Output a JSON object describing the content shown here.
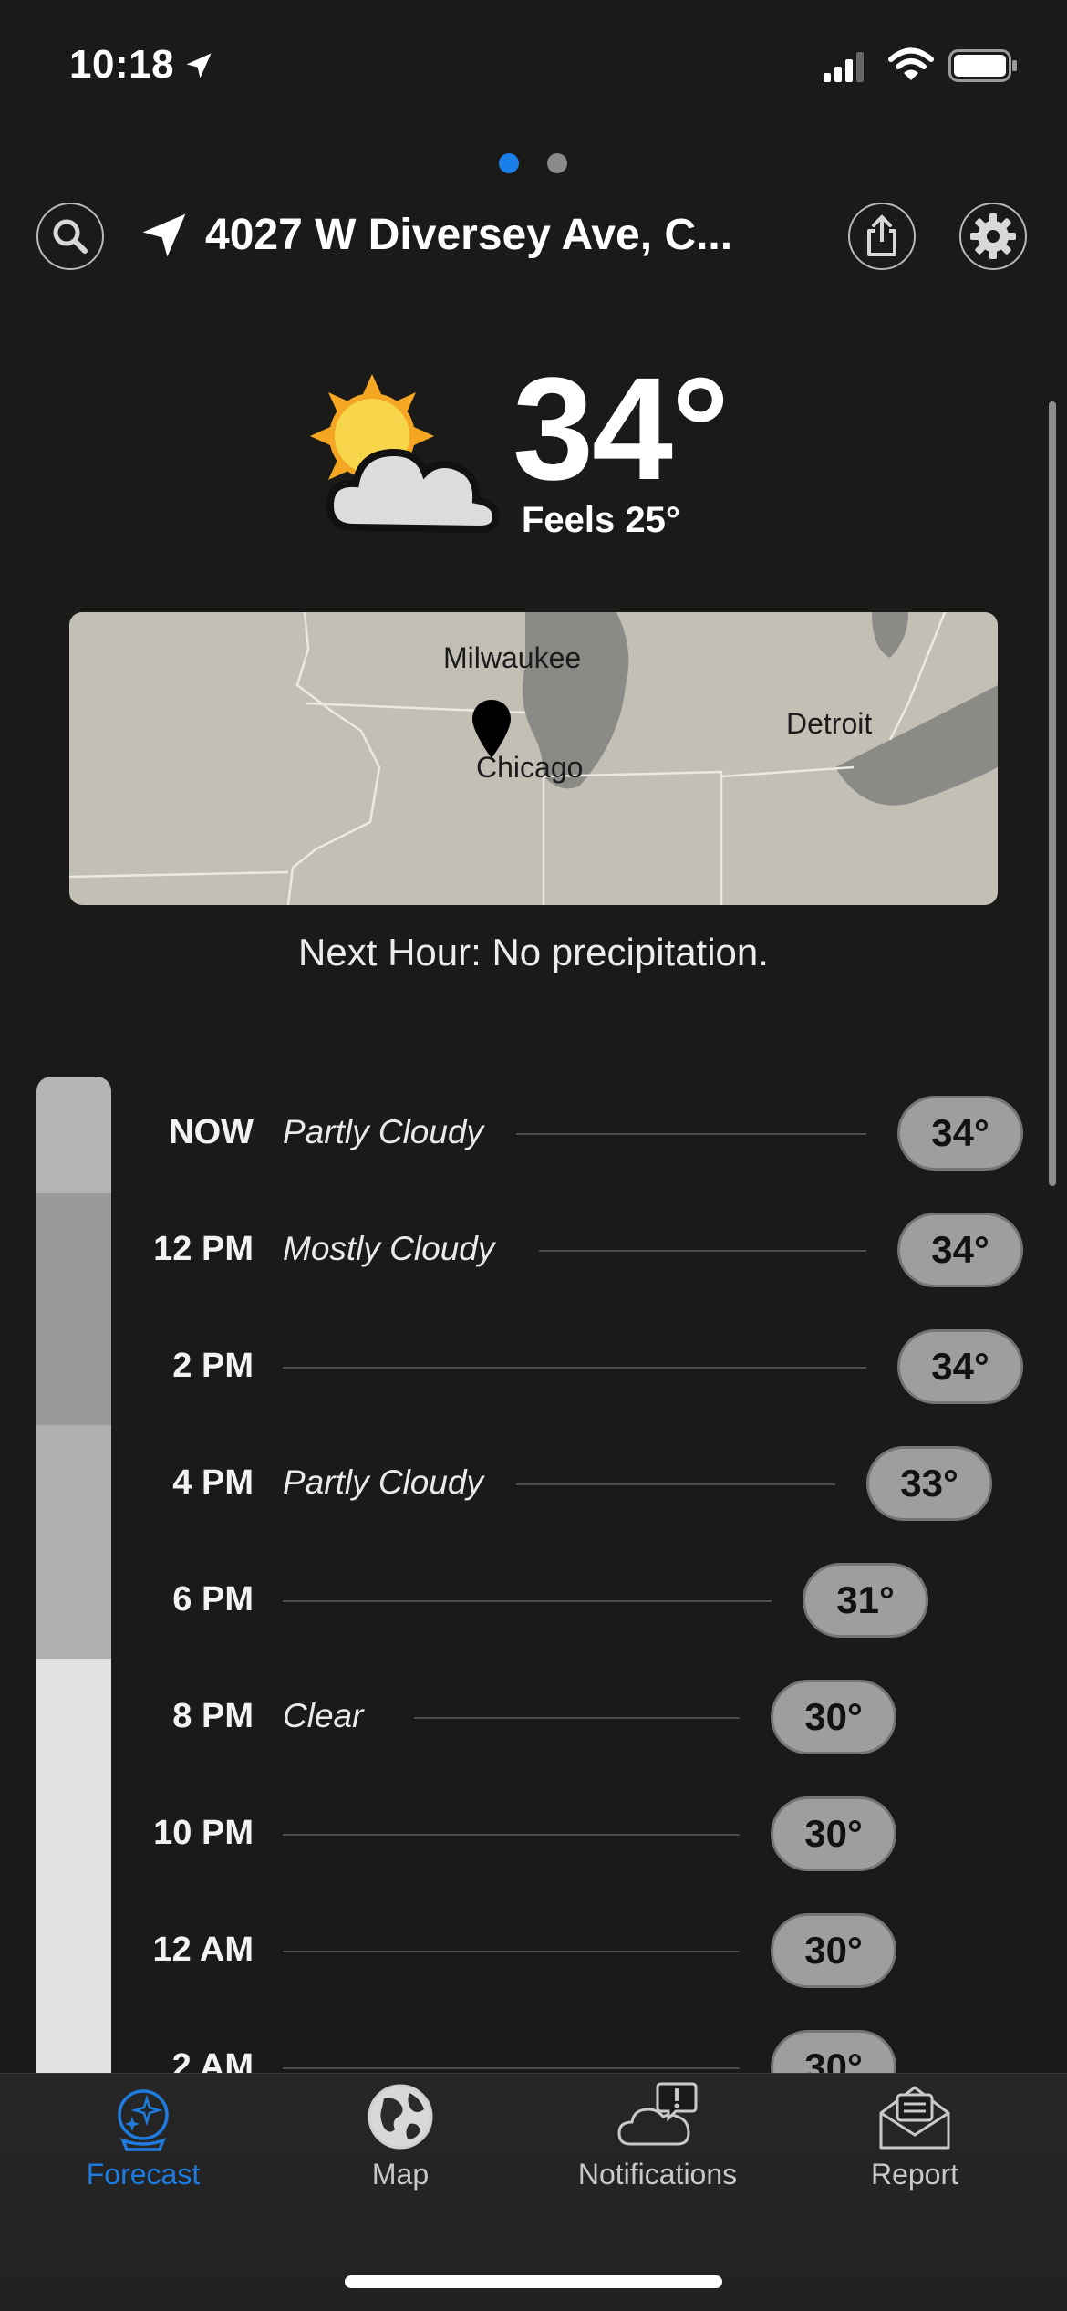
{
  "status_bar": {
    "time": "10:18"
  },
  "header": {
    "address": "4027 W Diversey Ave, C..."
  },
  "current": {
    "temperature": "34°",
    "feels_like": "Feels 25°",
    "icon": "partly-cloudy-icon"
  },
  "map": {
    "labels": {
      "milwaukee": "Milwaukee",
      "chicago": "Chicago",
      "detroit": "Detroit"
    }
  },
  "next_hour": "Next Hour: No precipitation.",
  "hourly": [
    {
      "time": "NOW",
      "condition": "Partly Cloudy",
      "temp": "34°"
    },
    {
      "time": "12 PM",
      "condition": "Mostly Cloudy",
      "temp": "34°"
    },
    {
      "time": "2 PM",
      "condition": "",
      "temp": "34°"
    },
    {
      "time": "4 PM",
      "condition": "Partly Cloudy",
      "temp": "33°"
    },
    {
      "time": "6 PM",
      "condition": "",
      "temp": "31°"
    },
    {
      "time": "8 PM",
      "condition": "Clear",
      "temp": "30°"
    },
    {
      "time": "10 PM",
      "condition": "",
      "temp": "30°"
    },
    {
      "time": "12 AM",
      "condition": "",
      "temp": "30°"
    },
    {
      "time": "2 AM",
      "condition": "",
      "temp": "30°"
    }
  ],
  "tabs": [
    {
      "label": "Forecast",
      "icon": "crystal-ball-icon",
      "active": true
    },
    {
      "label": "Map",
      "icon": "globe-icon",
      "active": false
    },
    {
      "label": "Notifications",
      "icon": "cloud-alert-icon",
      "active": false
    },
    {
      "label": "Report",
      "icon": "envelope-icon",
      "active": false
    }
  ],
  "colors": {
    "accent": "#1e7ce0",
    "background": "#1a1a18",
    "pill": "#9e9e9e"
  }
}
